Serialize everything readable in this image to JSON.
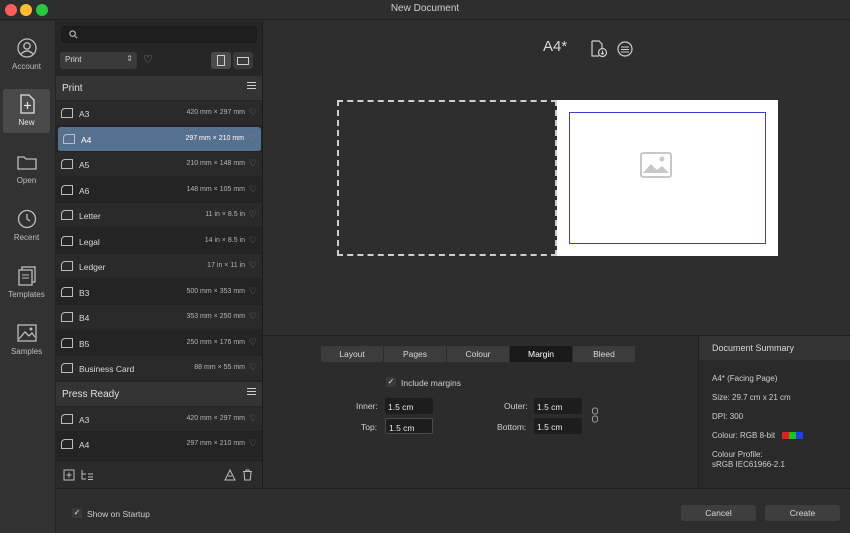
{
  "window": {
    "title": "New Document"
  },
  "nav": [
    {
      "label": "Account",
      "icon": "account-icon"
    },
    {
      "label": "New",
      "icon": "new-document-icon",
      "active": true
    },
    {
      "label": "Open",
      "icon": "folder-icon"
    },
    {
      "label": "Recent",
      "icon": "clock-icon"
    },
    {
      "label": "Templates",
      "icon": "templates-icon"
    },
    {
      "label": "Samples",
      "icon": "image-icon"
    }
  ],
  "list": {
    "search_placeholder": "",
    "filter_value": "Print",
    "sections": [
      {
        "title": "Print",
        "items": [
          {
            "name": "A3",
            "size": "420 mm × 297 mm"
          },
          {
            "name": "A4",
            "size": "297 mm × 210 mm",
            "selected": true
          },
          {
            "name": "A5",
            "size": "210 mm × 148 mm"
          },
          {
            "name": "A6",
            "size": "148 mm × 105 mm"
          },
          {
            "name": "Letter",
            "size": "11 in × 8.5 in"
          },
          {
            "name": "Legal",
            "size": "14 in × 8.5 in"
          },
          {
            "name": "Ledger",
            "size": "17 in × 11 in"
          },
          {
            "name": "B3",
            "size": "500 mm × 353 mm"
          },
          {
            "name": "B4",
            "size": "353 mm × 250 mm"
          },
          {
            "name": "B5",
            "size": "250 mm × 176 mm"
          },
          {
            "name": "Business Card",
            "size": "88 mm × 55 mm"
          }
        ]
      },
      {
        "title": "Press Ready",
        "items": [
          {
            "name": "A3",
            "size": "420 mm × 297 mm"
          },
          {
            "name": "A4",
            "size": "297 mm × 210 mm"
          }
        ]
      }
    ]
  },
  "preview": {
    "title": "A4*"
  },
  "tabs": [
    {
      "label": "Layout"
    },
    {
      "label": "Pages"
    },
    {
      "label": "Colour"
    },
    {
      "label": "Margin",
      "active": true
    },
    {
      "label": "Bleed"
    }
  ],
  "margin": {
    "include_label": "Include margins",
    "include_checked": true,
    "inner_label": "Inner:",
    "inner_value": "1.5 cm",
    "top_label": "Top:",
    "top_value": "1.5 cm",
    "outer_label": "Outer:",
    "outer_value": "1.5 cm",
    "bottom_label": "Bottom:",
    "bottom_value": "1.5 cm"
  },
  "summary": {
    "heading": "Document Summary",
    "page": "A4* (Facing Page)",
    "size": "Size: 29.7 cm x 21 cm",
    "dpi": "DPI:  300",
    "colour": "Colour: RGB 8-bit",
    "profile_label": "Colour Profile:",
    "profile_value": "sRGB IEC61966-2.1",
    "swatches": [
      "#e02020",
      "#20c020",
      "#2040e0"
    ]
  },
  "footer": {
    "startup_label": "Show on Startup",
    "startup_checked": true,
    "cancel_label": "Cancel",
    "create_label": "Create"
  }
}
